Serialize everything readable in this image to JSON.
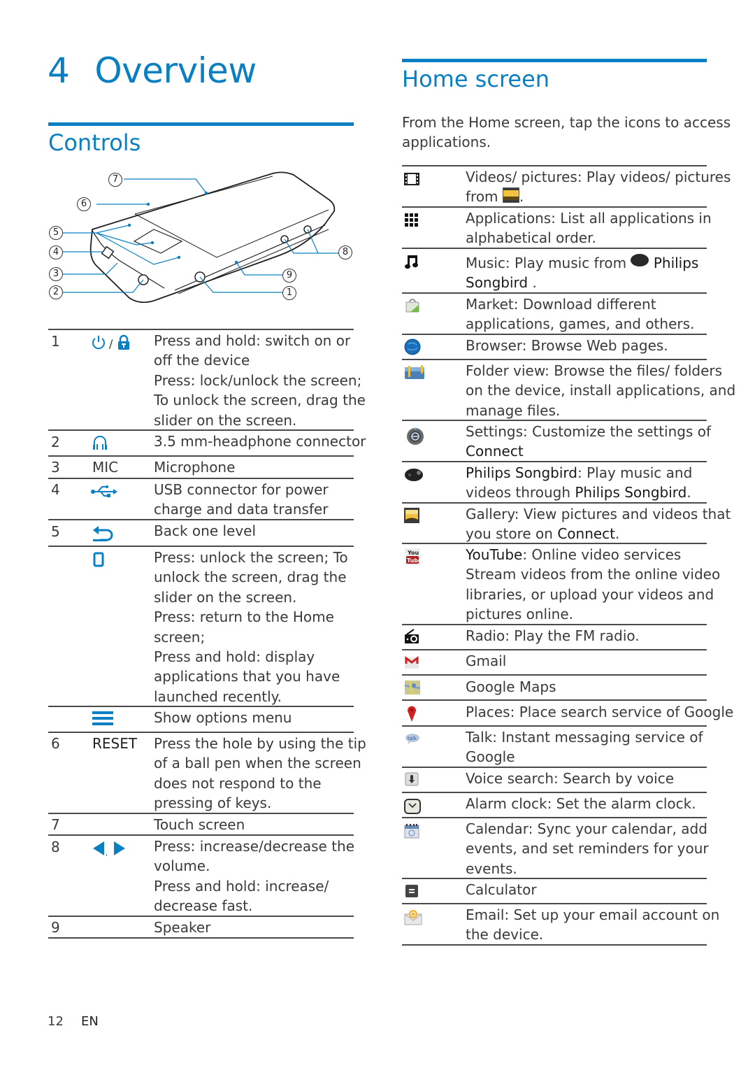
{
  "chapter": {
    "number": "4",
    "title": "Overview"
  },
  "controls": {
    "title": "Controls",
    "diagram_callouts": [
      "1",
      "2",
      "3",
      "4",
      "5",
      "6",
      "7",
      "8",
      "9"
    ],
    "rows": [
      {
        "num": "1",
        "icon": "power-lock-icon",
        "icon_sep": "/",
        "lines": [
          "Press and hold: switch on or",
          "off the device",
          "Press: lock/unlock the screen;",
          "To unlock the screen, drag the",
          "slider on the screen."
        ]
      },
      {
        "num": "2",
        "icon": "headphone-icon",
        "lines": [
          "3.5 mm-headphone connector"
        ]
      },
      {
        "num": "3",
        "label": "MIC",
        "lines": [
          "Microphone"
        ]
      },
      {
        "num": "4",
        "icon": "usb-icon",
        "lines": [
          "USB connector for power",
          "charge and data transfer"
        ]
      },
      {
        "num": "5",
        "icon": "back-icon",
        "lines": [
          "Back one level"
        ]
      },
      {
        "num": "",
        "icon": "home-icon",
        "lines": [
          "Press: unlock the screen; To",
          "unlock the screen, drag the",
          "slider on the screen.",
          "Press: return to the Home",
          "screen;",
          "Press and hold: display",
          "applications that you have",
          "launched recently."
        ]
      },
      {
        "num": "",
        "icon": "menu-icon",
        "lines": [
          "Show options menu"
        ]
      },
      {
        "num": "6",
        "label": "RESET",
        "lines": [
          "Press the hole by using the tip",
          "of a ball pen when the screen",
          "does not respond to the",
          "pressing of keys."
        ]
      },
      {
        "num": "7",
        "lines": [
          "Touch screen"
        ]
      },
      {
        "num": "8",
        "icon": "volume-icon",
        "icon_sep": ",",
        "lines": [
          "Press: increase/decrease the",
          "volume.",
          "Press and hold: increase/",
          "decrease fast."
        ]
      },
      {
        "num": "9",
        "lines": [
          "Speaker"
        ]
      }
    ]
  },
  "home_screen": {
    "title": "Home screen",
    "intro_lines": [
      "From the Home screen, tap the icons to access",
      "applications."
    ],
    "rows": [
      {
        "icon": "video-icon",
        "lines": [
          "Videos/ pictures: Play videos/ pictures",
          "from [gallery]."
        ]
      },
      {
        "icon": "apps-grid-icon",
        "lines": [
          "Applications: List all applications in",
          "alphabetical order."
        ]
      },
      {
        "icon": "music-note-icon",
        "lines": [
          "Music: Play music from [songbird] Philips",
          "Songbird ."
        ]
      },
      {
        "icon": "market-icon",
        "lines": [
          "Market: Download different",
          "applications, games, and others."
        ]
      },
      {
        "icon": "browser-globe-icon",
        "lines": [
          "Browser: Browse Web pages."
        ]
      },
      {
        "icon": "folder-icon",
        "lines": [
          "Folder view: Browse the files/ folders",
          "on the device, install applications, and",
          "manage files."
        ]
      },
      {
        "icon": "settings-icon",
        "lines": [
          "Settings: Customize the settings of",
          "Connect"
        ]
      },
      {
        "icon": "songbird-icon",
        "lines": [
          "Philips Songbird: Play music and",
          "videos through Philips Songbird."
        ]
      },
      {
        "icon": "gallery-icon",
        "lines": [
          "Gallery: View pictures and videos that",
          "you store on Connect."
        ]
      },
      {
        "icon": "youtube-icon",
        "lines": [
          "YouTube: Online video services",
          "Stream videos from the online video",
          "libraries, or upload your videos and",
          "pictures online."
        ]
      },
      {
        "icon": "radio-icon",
        "lines": [
          "Radio: Play the FM radio."
        ]
      },
      {
        "icon": "gmail-icon",
        "lines": [
          "Gmail"
        ]
      },
      {
        "icon": "maps-icon",
        "lines": [
          "Google Maps"
        ]
      },
      {
        "icon": "places-pin-icon",
        "lines": [
          "Places: Place search service of Google"
        ]
      },
      {
        "icon": "talk-icon",
        "lines": [
          "Talk: Instant messaging service of",
          "Google"
        ]
      },
      {
        "icon": "voice-search-icon",
        "lines": [
          "Voice search: Search by voice"
        ]
      },
      {
        "icon": "alarm-clock-icon",
        "lines": [
          "Alarm clock: Set the alarm clock."
        ]
      },
      {
        "icon": "calendar-icon",
        "lines": [
          "Calendar: Sync your calendar, add",
          "events, and set reminders for your",
          "events."
        ]
      },
      {
        "icon": "calculator-icon",
        "lines": [
          "Calculator"
        ]
      },
      {
        "icon": "email-icon",
        "lines": [
          "Email: Set up your email account on",
          "the device."
        ]
      }
    ]
  },
  "footer": {
    "page": "12",
    "lang": "EN"
  },
  "colors": {
    "accent": "#0a7fc1",
    "text": "#3a3a3a",
    "rule": "#4a4a4a"
  }
}
